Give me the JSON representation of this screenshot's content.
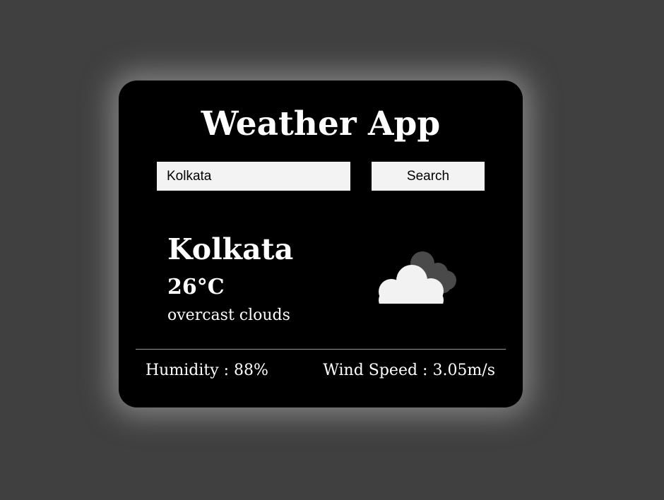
{
  "app": {
    "title": "Weather App"
  },
  "search": {
    "value": "Kolkata",
    "button_label": "Search"
  },
  "current": {
    "city": "Kolkata",
    "temperature": "26°C",
    "description": "overcast clouds",
    "icon": "overcast-clouds-icon"
  },
  "details": {
    "humidity": "Humidity : 88%",
    "wind_speed": "Wind Speed : 3.05m/s"
  },
  "colors": {
    "page_background": "#404040",
    "card_background": "#000000",
    "input_background": "#f3f3f3",
    "text": "#ffffff"
  }
}
